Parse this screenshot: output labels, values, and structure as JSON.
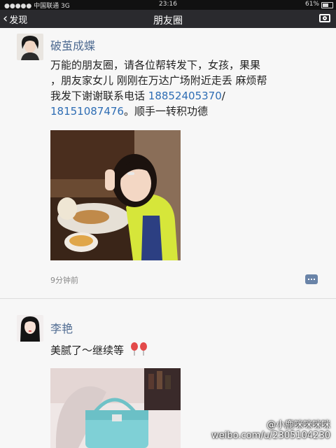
{
  "status_bar": {
    "carrier": "●●●●● 中国联通 3G",
    "time": "23:16",
    "battery": "61%"
  },
  "nav": {
    "back_label": "发现",
    "title": "朋友圈"
  },
  "posts": [
    {
      "author": "破茧成蝶",
      "text_line1": "万能的朋友圈，请各位帮转发下，女孩，果果",
      "text_line2": "，朋友家女儿 刚刚在万达广场附近走丢 麻烦帮",
      "text_line3_prefix": "我发下谢谢联系电话 ",
      "phone1": "18852405370",
      "text_slash": "/",
      "phone2": "18151087476",
      "text_suffix": "。顺手一转积功德",
      "time_ago": "9分钟前"
    },
    {
      "author": "李艳",
      "text": "美腻了～继续等"
    }
  ],
  "watermark": {
    "line1": "@小鹿咪咪咪咪",
    "line2": "weibo.com/u/2305104230"
  },
  "colors": {
    "nav_bg": "#2a2a2e",
    "name_blue": "#4f6b91",
    "link_blue": "#2e6db4"
  }
}
